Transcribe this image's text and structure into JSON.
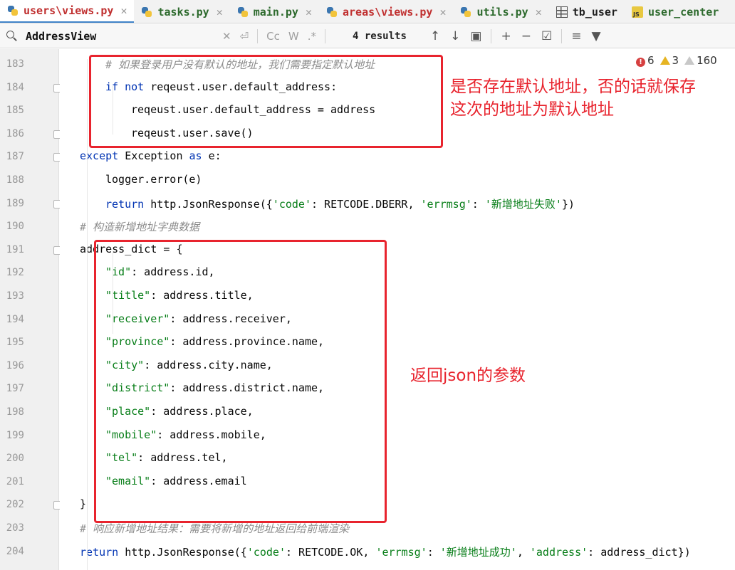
{
  "tabs": [
    {
      "label": "users\\views.py",
      "icon": "python-file-icon",
      "active": true,
      "style": "red"
    },
    {
      "label": "tasks.py",
      "icon": "python-file-icon",
      "style": "dark"
    },
    {
      "label": "main.py",
      "icon": "python-file-icon",
      "style": "dark"
    },
    {
      "label": "areas\\views.py",
      "icon": "python-file-icon",
      "style": "red"
    },
    {
      "label": "utils.py",
      "icon": "python-file-icon",
      "style": "dark"
    },
    {
      "label": "tb_user",
      "icon": "table-icon",
      "style": "plain"
    },
    {
      "label": "user_center",
      "icon": "js-file-icon",
      "style": "dark"
    }
  ],
  "search": {
    "query": "AddressView",
    "results": "4 results",
    "match_case": "Cc",
    "words": "W",
    "regex": ".*"
  },
  "inspections": {
    "errors": "6",
    "warnings": "3",
    "weak_warnings": "160"
  },
  "code_lines": [
    {
      "n": "183",
      "indent": 2,
      "tokens": [
        [
          "cm",
          "# 如果登录用户没有默认的地址，我们需要指定默认地址"
        ]
      ]
    },
    {
      "n": "184",
      "indent": 2,
      "tokens": [
        [
          "kw",
          "if not "
        ],
        [
          "",
          "reqeust.user.default_address:"
        ]
      ],
      "fold": true
    },
    {
      "n": "185",
      "indent": 3,
      "tokens": [
        [
          "",
          "reqeust.user.default_address = address"
        ]
      ]
    },
    {
      "n": "186",
      "indent": 3,
      "tokens": [
        [
          "",
          "reqeust.user.save()"
        ]
      ],
      "fold": true
    },
    {
      "n": "187",
      "indent": 1,
      "tokens": [
        [
          "kw",
          "except "
        ],
        [
          "",
          "Exception "
        ],
        [
          "kw",
          "as "
        ],
        [
          "",
          "e:"
        ]
      ],
      "fold": true
    },
    {
      "n": "188",
      "indent": 2,
      "tokens": [
        [
          "",
          "logger.error(e)"
        ]
      ]
    },
    {
      "n": "189",
      "indent": 2,
      "tokens": [
        [
          "kw",
          "return "
        ],
        [
          "",
          "http.JsonResponse({"
        ],
        [
          "str",
          "'code'"
        ],
        [
          "",
          ": RETCODE.DBERR, "
        ],
        [
          "str",
          "'errmsg'"
        ],
        [
          "",
          ": "
        ],
        [
          "str",
          "'新增地址失败'"
        ],
        [
          "",
          "})"
        ]
      ],
      "fold": true
    },
    {
      "n": "190",
      "indent": 1,
      "tokens": [
        [
          "cm",
          "# 构造新增地址字典数据"
        ]
      ]
    },
    {
      "n": "191",
      "indent": 1,
      "tokens": [
        [
          "",
          "address_dict = {"
        ]
      ],
      "fold": true
    },
    {
      "n": "192",
      "indent": 2,
      "tokens": [
        [
          "str",
          "\"id\""
        ],
        [
          "",
          ": address.id,"
        ]
      ]
    },
    {
      "n": "193",
      "indent": 2,
      "tokens": [
        [
          "str",
          "\"title\""
        ],
        [
          "",
          ": address.title,"
        ]
      ]
    },
    {
      "n": "194",
      "indent": 2,
      "tokens": [
        [
          "str",
          "\"receiver\""
        ],
        [
          "",
          ": address.receiver,"
        ]
      ]
    },
    {
      "n": "195",
      "indent": 2,
      "tokens": [
        [
          "str",
          "\"province\""
        ],
        [
          "",
          ": address.province.name,"
        ]
      ]
    },
    {
      "n": "196",
      "indent": 2,
      "tokens": [
        [
          "str",
          "\"city\""
        ],
        [
          "",
          ": address.city.name,"
        ]
      ]
    },
    {
      "n": "197",
      "indent": 2,
      "tokens": [
        [
          "str",
          "\"district\""
        ],
        [
          "",
          ": address.district.name,"
        ]
      ]
    },
    {
      "n": "198",
      "indent": 2,
      "tokens": [
        [
          "str",
          "\"place\""
        ],
        [
          "",
          ": address.place,"
        ]
      ]
    },
    {
      "n": "199",
      "indent": 2,
      "tokens": [
        [
          "str",
          "\"mobile\""
        ],
        [
          "",
          ": address.mobile,"
        ]
      ]
    },
    {
      "n": "200",
      "indent": 2,
      "tokens": [
        [
          "str",
          "\"tel\""
        ],
        [
          "",
          ": address.tel,"
        ]
      ]
    },
    {
      "n": "201",
      "indent": 2,
      "tokens": [
        [
          "str",
          "\"email\""
        ],
        [
          "",
          ": address.email"
        ]
      ]
    },
    {
      "n": "202",
      "indent": 1,
      "tokens": [
        [
          "",
          "}"
        ]
      ],
      "fold": true
    },
    {
      "n": "203",
      "indent": 1,
      "tokens": [
        [
          "cm",
          "# 响应新增地址结果：需要将新增的地址返回给前端渲染"
        ]
      ]
    },
    {
      "n": "204",
      "indent": 1,
      "tokens": [
        [
          "kw",
          "return "
        ],
        [
          "",
          "http.JsonResponse({"
        ],
        [
          "str",
          "'code'"
        ],
        [
          "",
          ": RETCODE.OK, "
        ],
        [
          "str",
          "'errmsg'"
        ],
        [
          "",
          ": "
        ],
        [
          "str",
          "'新增地址成功'"
        ],
        [
          "",
          ", "
        ],
        [
          "str",
          "'address'"
        ],
        [
          "",
          ": address_dict})"
        ]
      ]
    }
  ],
  "annotations": {
    "note1_line1": "是否存在默认地址，否的话就保存",
    "note1_line2": "这次的地址为默认地址",
    "note2": "返回json的参数"
  },
  "colors": {
    "annotation": "#e8242e",
    "keyword": "#0033b3",
    "string": "#067d17",
    "comment": "#8c8c8c"
  }
}
